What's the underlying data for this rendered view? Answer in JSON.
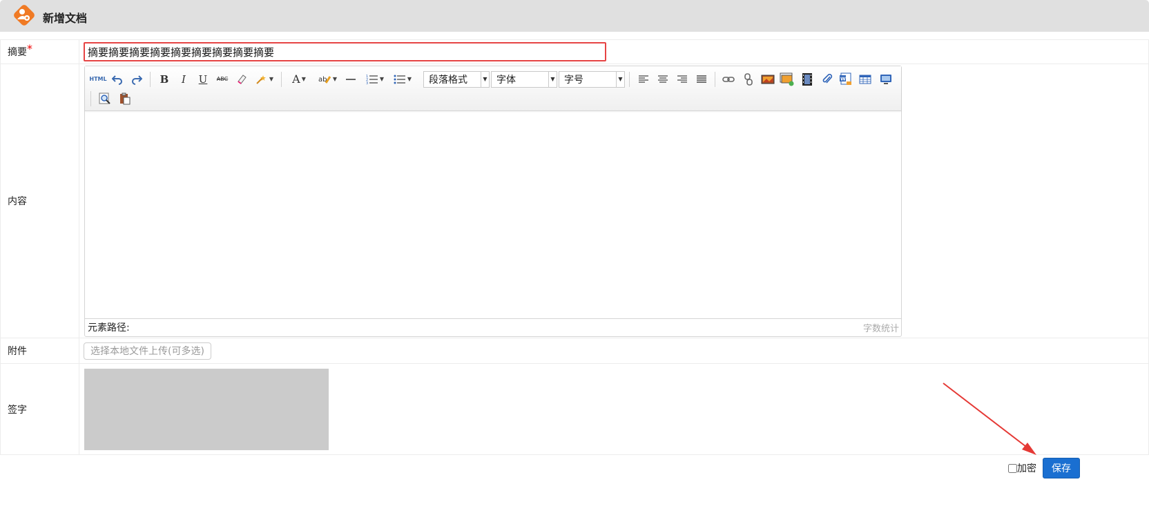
{
  "header": {
    "title": "新增文档",
    "icon": "user-settings-icon",
    "accent": "#f07a24"
  },
  "form": {
    "summary": {
      "label": "摘要",
      "required_mark": "*",
      "value": "摘要摘要摘要摘要摘要摘要摘要摘要摘要"
    },
    "content": {
      "label": "内容"
    },
    "attachment": {
      "label": "附件",
      "button_label": "选择本地文件上传(可多选)"
    },
    "signature": {
      "label": "签字"
    }
  },
  "editor": {
    "toolbar": {
      "html_label": "HTML",
      "paragraph_select": "段落格式",
      "font_select": "字体",
      "size_select": "字号"
    },
    "status": {
      "path_label": "元素路径:",
      "word_count_label": "字数统计"
    }
  },
  "footer": {
    "encrypt_label": "加密",
    "encrypt_checked": false,
    "save_label": "保存",
    "save_color": "#1a6fd1"
  },
  "annotation": {
    "color": "#e53935"
  }
}
